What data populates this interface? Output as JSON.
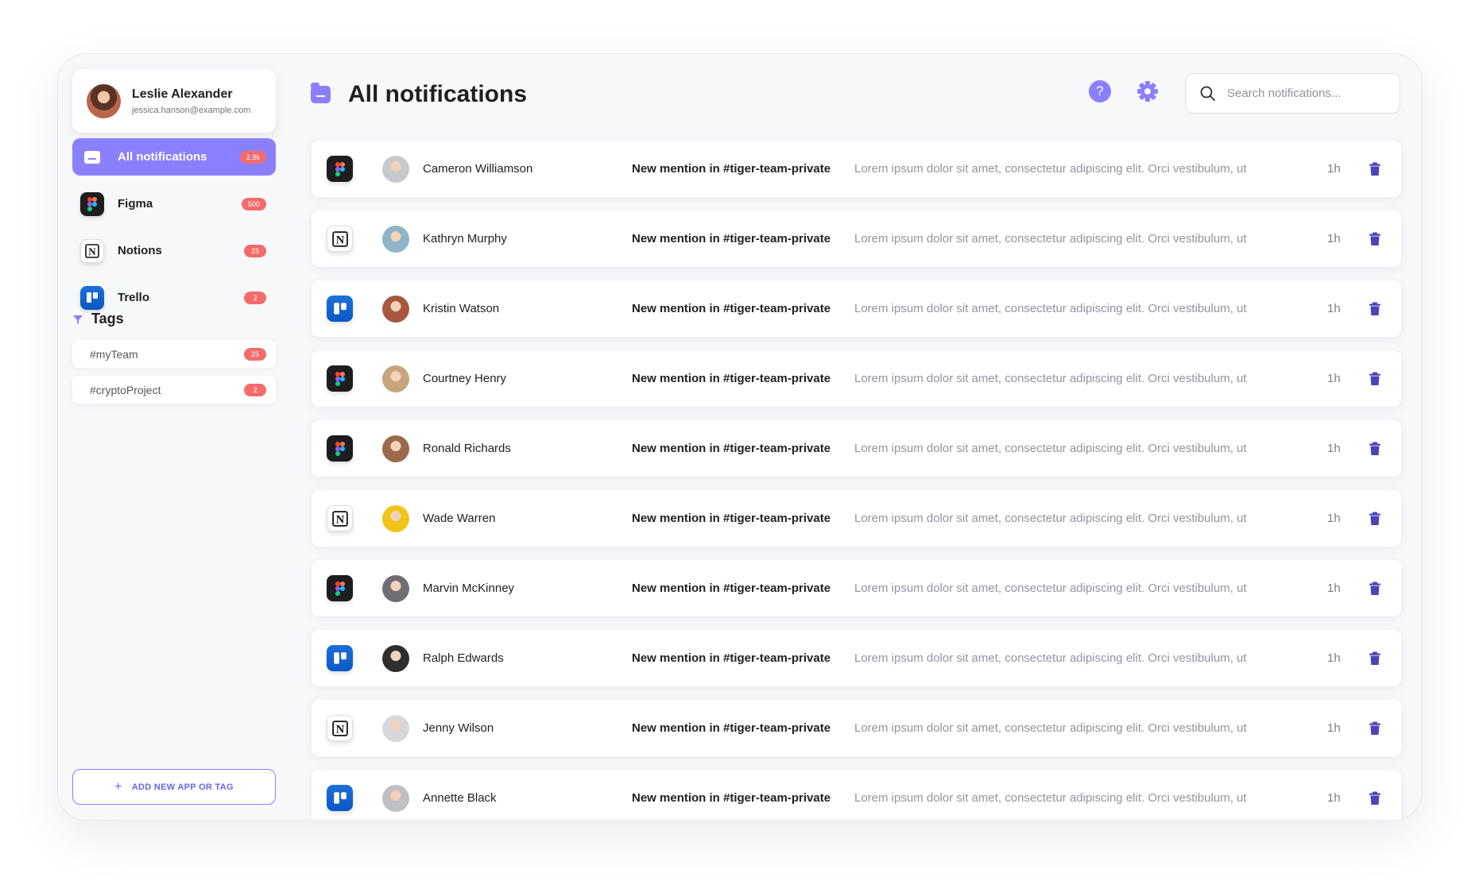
{
  "profile": {
    "name": "Leslie Alexander",
    "email": "jessica.hanson@example.com"
  },
  "nav": [
    {
      "label": "All notifications",
      "count": "2.8k",
      "active": true,
      "icon": "folder-icon"
    },
    {
      "label": "Figma",
      "count": "500",
      "active": false,
      "icon": "figma-icon"
    },
    {
      "label": "Notions",
      "count": "25",
      "active": false,
      "icon": "notion-icon"
    },
    {
      "label": "Trello",
      "count": "2",
      "active": false,
      "icon": "trello-icon"
    }
  ],
  "tags": {
    "title": "Tags",
    "items": [
      {
        "label": "#myTeam",
        "count": "25"
      },
      {
        "label": "#cryptoProject",
        "count": "2"
      }
    ]
  },
  "add_button": {
    "label": "ADD NEW APP OR TAG"
  },
  "header": {
    "title": "All notifications"
  },
  "search": {
    "placeholder": "Search notifications..."
  },
  "colors": {
    "accent": "#8a80ff",
    "badge": "#f36b6b",
    "trash": "#4b44b8"
  },
  "notifications": [
    {
      "app": "figma",
      "name": "Cameron Williamson",
      "title": "New mention in #tiger-team-private",
      "preview": "Lorem ipsum dolor sit amet, consectetur adipiscing elit. Orci vestibulum, ut",
      "time": "1h"
    },
    {
      "app": "notion",
      "name": "Kathryn Murphy",
      "title": "New mention in #tiger-team-private",
      "preview": "Lorem ipsum dolor sit amet, consectetur adipiscing elit. Orci vestibulum, ut",
      "time": "1h"
    },
    {
      "app": "trello",
      "name": "Kristin Watson",
      "title": "New mention in #tiger-team-private",
      "preview": "Lorem ipsum dolor sit amet, consectetur adipiscing elit. Orci vestibulum, ut",
      "time": "1h"
    },
    {
      "app": "figma",
      "name": "Courtney Henry",
      "title": "New mention in #tiger-team-private",
      "preview": "Lorem ipsum dolor sit amet, consectetur adipiscing elit. Orci vestibulum, ut",
      "time": "1h"
    },
    {
      "app": "figma",
      "name": "Ronald Richards",
      "title": "New mention in #tiger-team-private",
      "preview": "Lorem ipsum dolor sit amet, consectetur adipiscing elit. Orci vestibulum, ut",
      "time": "1h"
    },
    {
      "app": "notion",
      "name": "Wade Warren",
      "title": "New mention in #tiger-team-private",
      "preview": "Lorem ipsum dolor sit amet, consectetur adipiscing elit. Orci vestibulum, ut",
      "time": "1h"
    },
    {
      "app": "figma",
      "name": "Marvin McKinney",
      "title": "New mention in #tiger-team-private",
      "preview": "Lorem ipsum dolor sit amet, consectetur adipiscing elit. Orci vestibulum, ut",
      "time": "1h"
    },
    {
      "app": "trello",
      "name": "Ralph Edwards",
      "title": "New mention in #tiger-team-private",
      "preview": "Lorem ipsum dolor sit amet, consectetur adipiscing elit. Orci vestibulum, ut",
      "time": "1h"
    },
    {
      "app": "notion",
      "name": "Jenny Wilson",
      "title": "New mention in #tiger-team-private",
      "preview": "Lorem ipsum dolor sit amet, consectetur adipiscing elit. Orci vestibulum, ut",
      "time": "1h"
    },
    {
      "app": "trello",
      "name": "Annette Black",
      "title": "New mention in #tiger-team-private",
      "preview": "Lorem ipsum dolor sit amet, consectetur adipiscing elit. Orci vestibulum, ut",
      "time": "1h"
    }
  ]
}
